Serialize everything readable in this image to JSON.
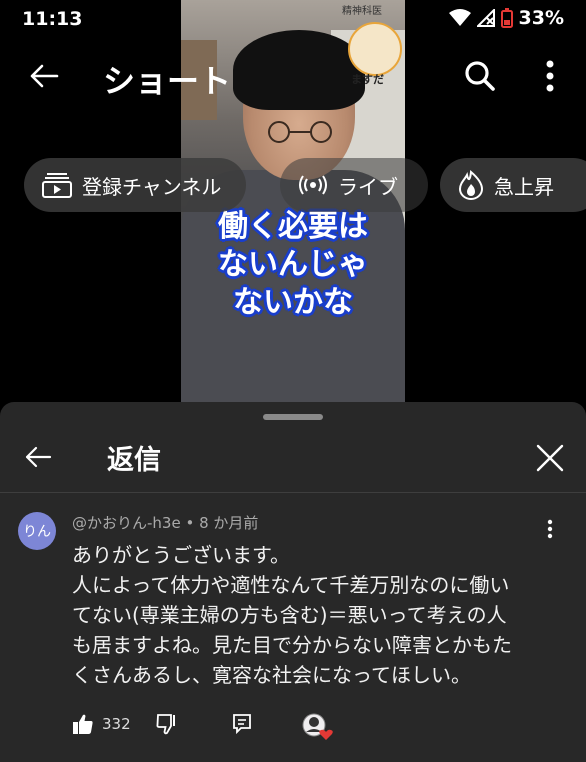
{
  "status_bar": {
    "time": "11:13",
    "battery": "33%"
  },
  "video": {
    "caption_lines": [
      "働く必要は",
      "ないんじゃ",
      "ないかな"
    ],
    "channel_badge_top": "精神科医",
    "channel_badge_name": "ますだ"
  },
  "topbar": {
    "title": "ショート"
  },
  "chips": [
    {
      "label": "登録チャンネル",
      "icon": "subscriptions-icon"
    },
    {
      "label": "ライブ",
      "icon": "live-icon"
    },
    {
      "label": "急上昇",
      "icon": "trending-icon"
    }
  ],
  "panel": {
    "title": "返信"
  },
  "comment": {
    "avatar_text": "りん",
    "author": "@かおりん-h3e",
    "time_ago": "8 か月前",
    "separator": "•",
    "lines": [
      "ありがとうございます。",
      "人によって体力や適性なんて千差万別なのに働い",
      "てない(専業主婦の方も含む)＝悪いって考えの人",
      "も居ますよね。見た目で分からない障害とかもた",
      "くさんあるし、寛容な社会になってほしい。"
    ],
    "like_count": "332"
  },
  "colors": {
    "panel_bg": "#282828",
    "avatar_bg": "#7d86d6",
    "caption_outline": "#1a3fcc",
    "heart": "#e53935"
  }
}
